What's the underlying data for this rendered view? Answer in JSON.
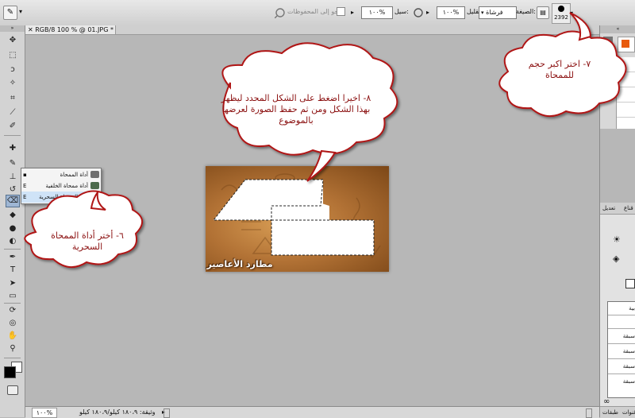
{
  "options_bar": {
    "brush_size": "2392",
    "mode_label": "الصيغة:",
    "mode_value": "فرشاة",
    "opacity_label": "التقليل:",
    "opacity_value": "١٠٠%",
    "flow_label": "سيل:",
    "flow_value": "١٠٠%",
    "history_label": "محو إلى المحفوظات"
  },
  "document_tab": {
    "title": "RGB/8 100 % @ 01.JPG *"
  },
  "tool_flyout": {
    "items": [
      {
        "key": "",
        "label": "أداة الممحاة",
        "color": "#6f6f6f"
      },
      {
        "key": "E",
        "label": "أداة ممحاة الخلفية",
        "color": "#4b6a4b"
      },
      {
        "key": "E",
        "label": "أداة الممحاة السحرية",
        "color": "#2a8ad8"
      }
    ]
  },
  "image": {
    "watermark": "مطارد الأعاصير"
  },
  "callouts": {
    "step6": "٦- أختر أداة الممحاة السحرية",
    "step7": "٧- اختر اكبر حجم للممحاة",
    "step8": "٨- اخيرا اضغط على الشكل المحدد ليظهر بهذا الشكل ومن ثم حفظ الصورة لعرضها بالموضوع"
  },
  "right_panel": {
    "tab_adjust": "تعديل",
    "tab_mask": "قناع",
    "tab_layers": "طبقات",
    "tab_channels": "قنوات",
    "rows": [
      "بية",
      "",
      "سبقة",
      "سبقة",
      "سبقة",
      "سبقة"
    ]
  },
  "status_bar": {
    "zoom": "١٠٠%",
    "doc_info": "وثيقة: ١٨٠،٩ كيلو/١٨٠،٩ كيلو"
  },
  "colors": {
    "callout_text": "#8b1010",
    "foreground": "#000000",
    "background": "#ffffff"
  }
}
